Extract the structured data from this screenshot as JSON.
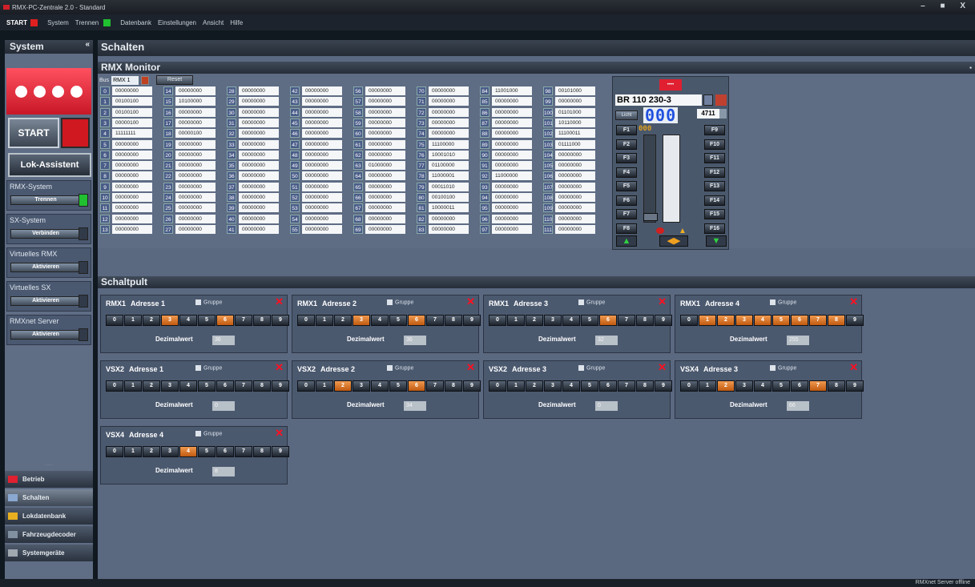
{
  "window": {
    "title": "RMX-PC-Zentrale 2.0 - Standard",
    "controls": "– ■ X"
  },
  "menu": {
    "start": "START",
    "system": "System",
    "trennen": "Trennen",
    "datenbank": "Datenbank",
    "einstellungen": "Einstellungen",
    "ansicht": "Ansicht",
    "hilfe": "Hilfe"
  },
  "sidebar": {
    "title": "System",
    "collapse": "«",
    "start_label": "START",
    "lok_label": "Lok-Assistent",
    "systems": [
      {
        "label": "RMX-System",
        "button": "Trennen",
        "active": true
      },
      {
        "label": "SX-System",
        "button": "Verbinden",
        "active": false
      },
      {
        "label": "Virtuelles RMX",
        "button": "Aktivieren",
        "active": false
      },
      {
        "label": "Virtuelles SX",
        "button": "Aktivieren",
        "active": false
      },
      {
        "label": "RMXnet Server",
        "button": "Aktivieren",
        "active": false
      }
    ],
    "nav": [
      {
        "label": "Betrieb",
        "icon": "rmx-logo-icon",
        "color": "#e02030"
      },
      {
        "label": "Schalten",
        "icon": "switch-icon",
        "color": "#8aa8d0",
        "active": true
      },
      {
        "label": "Lokdatenbank",
        "icon": "database-icon",
        "color": "#e8b020"
      },
      {
        "label": "Fahrzeugdecoder",
        "icon": "decoder-icon",
        "color": "#8090a0"
      },
      {
        "label": "Systemgeräte",
        "icon": "device-icon",
        "color": "#a0a8b0"
      }
    ]
  },
  "main": {
    "title": "Schalten"
  },
  "monitor": {
    "title": "RMX Monitor",
    "bus_label": "Bus",
    "bus_value": "RMX 1",
    "reset_label": "Reset",
    "rows": [
      [
        "0",
        "00000000",
        "14",
        "00000000",
        "28",
        "00000000",
        "42",
        "00000000",
        "56",
        "00000000",
        "70",
        "00000000",
        "84",
        "11001000",
        "98",
        "00101000"
      ],
      [
        "1",
        "00100100",
        "15",
        "10100000",
        "29",
        "00000000",
        "43",
        "00000000",
        "57",
        "00000000",
        "71",
        "00000000",
        "85",
        "00000000",
        "99",
        "00000000"
      ],
      [
        "2",
        "00100100",
        "16",
        "00000000",
        "30",
        "00000000",
        "44",
        "00000000",
        "58",
        "00000000",
        "72",
        "00000000",
        "86",
        "00000000",
        "100",
        "01101000"
      ],
      [
        "3",
        "00000100",
        "17",
        "00000000",
        "31",
        "00000000",
        "45",
        "00000000",
        "59",
        "00000000",
        "73",
        "00000000",
        "87",
        "00000000",
        "101",
        "10110000"
      ],
      [
        "4",
        "11111111",
        "18",
        "00000100",
        "32",
        "00000000",
        "46",
        "00000000",
        "60",
        "00000000",
        "74",
        "00000000",
        "88",
        "00000000",
        "102",
        "11100011"
      ],
      [
        "5",
        "00000000",
        "19",
        "00000000",
        "33",
        "00000000",
        "47",
        "00000000",
        "61",
        "00000000",
        "75",
        "11100000",
        "89",
        "00000000",
        "103",
        "01111000"
      ],
      [
        "6",
        "00000000",
        "20",
        "00000000",
        "34",
        "00000000",
        "48",
        "00000000",
        "62",
        "00000000",
        "76",
        "10001010",
        "90",
        "00000000",
        "104",
        "00000000"
      ],
      [
        "7",
        "00000000",
        "21",
        "00000000",
        "35",
        "00000000",
        "49",
        "00000000",
        "63",
        "01000000",
        "77",
        "01100000",
        "91",
        "00000000",
        "105",
        "00000000"
      ],
      [
        "8",
        "00000000",
        "22",
        "00000000",
        "36",
        "00000000",
        "50",
        "00000000",
        "64",
        "00000000",
        "78",
        "11000001",
        "92",
        "11000000",
        "106",
        "00000000"
      ],
      [
        "9",
        "00000000",
        "23",
        "00000000",
        "37",
        "00000000",
        "51",
        "00000000",
        "65",
        "00000000",
        "79",
        "00011010",
        "93",
        "00000000",
        "107",
        "00000000"
      ],
      [
        "10",
        "00000000",
        "24",
        "00000000",
        "38",
        "00000000",
        "52",
        "00000000",
        "66",
        "00000000",
        "80",
        "00100100",
        "94",
        "00000000",
        "108",
        "00000000"
      ],
      [
        "11",
        "00000000",
        "25",
        "00000000",
        "39",
        "00000000",
        "53",
        "00000000",
        "67",
        "00000000",
        "81",
        "10000011",
        "95",
        "00000000",
        "109",
        "00000000"
      ],
      [
        "12",
        "00000000",
        "26",
        "00000000",
        "40",
        "00000000",
        "54",
        "00000000",
        "68",
        "00000000",
        "82",
        "00000000",
        "96",
        "00000000",
        "110",
        "00000000"
      ],
      [
        "13",
        "00000000",
        "27",
        "00000000",
        "41",
        "00000000",
        "55",
        "00000000",
        "69",
        "00000000",
        "83",
        "00000000",
        "97",
        "00000000",
        "111",
        "00000000"
      ]
    ]
  },
  "loco": {
    "logo": "••••",
    "name": "BR 110 230-3",
    "licht": "Licht",
    "speed": "000",
    "address": "4711",
    "fn_display": "000",
    "left_fns": [
      "F1",
      "F2",
      "F3",
      "F4",
      "F5",
      "F6",
      "F7",
      "F8"
    ],
    "right_fns": [
      "F9",
      "F10",
      "F11",
      "F12",
      "F13",
      "F14",
      "F15",
      "F16"
    ]
  },
  "schaltpult": {
    "title": "Schaltpult",
    "gruppe_label": "Gruppe",
    "dezimal_label": "Dezimalwert",
    "bit_labels": [
      "0",
      "1",
      "2",
      "3",
      "4",
      "5",
      "6",
      "7",
      "8",
      "9"
    ],
    "cards": [
      {
        "bus": "RMX1",
        "adresse": "Adresse 1",
        "on": [
          3,
          6
        ],
        "value": "36"
      },
      {
        "bus": "RMX1",
        "adresse": "Adresse 2",
        "on": [
          3,
          6
        ],
        "value": "36"
      },
      {
        "bus": "RMX1",
        "adresse": "Adresse 3",
        "on": [
          6
        ],
        "value": "32"
      },
      {
        "bus": "RMX1",
        "adresse": "Adresse 4",
        "on": [
          1,
          2,
          3,
          4,
          5,
          6,
          7,
          8
        ],
        "value": "255"
      },
      {
        "bus": "VSX2",
        "adresse": "Adresse 1",
        "on": [],
        "value": "0"
      },
      {
        "bus": "VSX2",
        "adresse": "Adresse 2",
        "on": [
          2,
          6
        ],
        "value": "34"
      },
      {
        "bus": "VSX2",
        "adresse": "Adresse 3",
        "on": [],
        "value": "0"
      },
      {
        "bus": "VSX4",
        "adresse": "Adresse 3",
        "on": [
          2,
          7
        ],
        "value": "66"
      },
      {
        "bus": "VSX4",
        "adresse": "Adresse 4",
        "on": [
          4
        ],
        "value": "8"
      }
    ]
  },
  "status": {
    "text": "RMXnet Server offline"
  }
}
